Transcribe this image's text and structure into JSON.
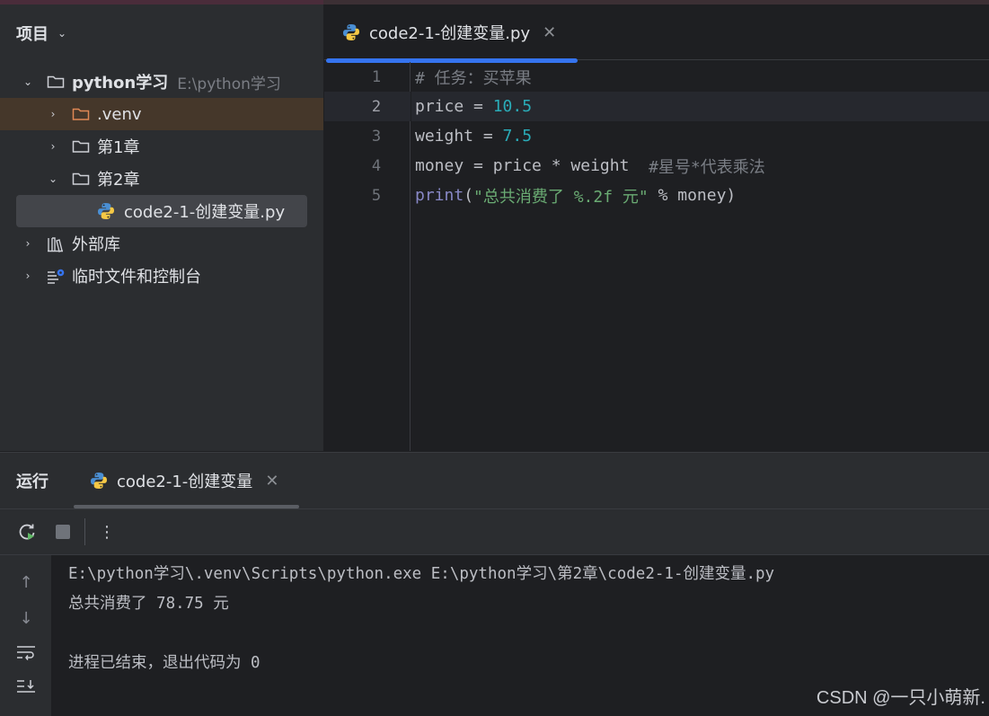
{
  "project_panel": {
    "title": "项目",
    "tree": [
      {
        "label": "python学习",
        "hint": "E:\\python学习",
        "expanded": true
      },
      {
        "label": ".venv",
        "expanded": false
      },
      {
        "label": "第1章",
        "expanded": false
      },
      {
        "label": "第2章",
        "expanded": true
      },
      {
        "label": "code2-1-创建变量.py",
        "selected": true
      },
      {
        "label": "外部库",
        "expanded": false
      },
      {
        "label": "临时文件和控制台",
        "expanded": false
      }
    ]
  },
  "editor": {
    "tab_label": "code2-1-创建变量.py",
    "line_numbers": [
      "1",
      "2",
      "3",
      "4",
      "5"
    ],
    "current_line": 2,
    "lines": [
      {
        "comment": "# 任务：买苹果"
      },
      {
        "code": "price = ",
        "number": "10.5"
      },
      {
        "code": "weight = ",
        "number": "7.5"
      },
      {
        "code": "money = price * weight  ",
        "comment": "#星号*代表乘法"
      },
      {
        "builtin": "print",
        "p1": "(",
        "string": "\"总共消费了 %.2f 元\"",
        "rest": " % money)"
      }
    ]
  },
  "run_panel": {
    "title": "运行",
    "tab_label": "code2-1-创建变量",
    "console": [
      "E:\\python学习\\.venv\\Scripts\\python.exe E:\\python学习\\第2章\\code2-1-创建变量.py",
      "总共消费了 78.75 元",
      "",
      "进程已结束，退出代码为 0"
    ]
  },
  "watermark": "CSDN @一只小萌新.",
  "colors": {
    "accent": "#3574f0",
    "number": "#2aacb8",
    "string": "#6aab73",
    "comment": "#7a7e85",
    "builtin": "#8888c6"
  }
}
